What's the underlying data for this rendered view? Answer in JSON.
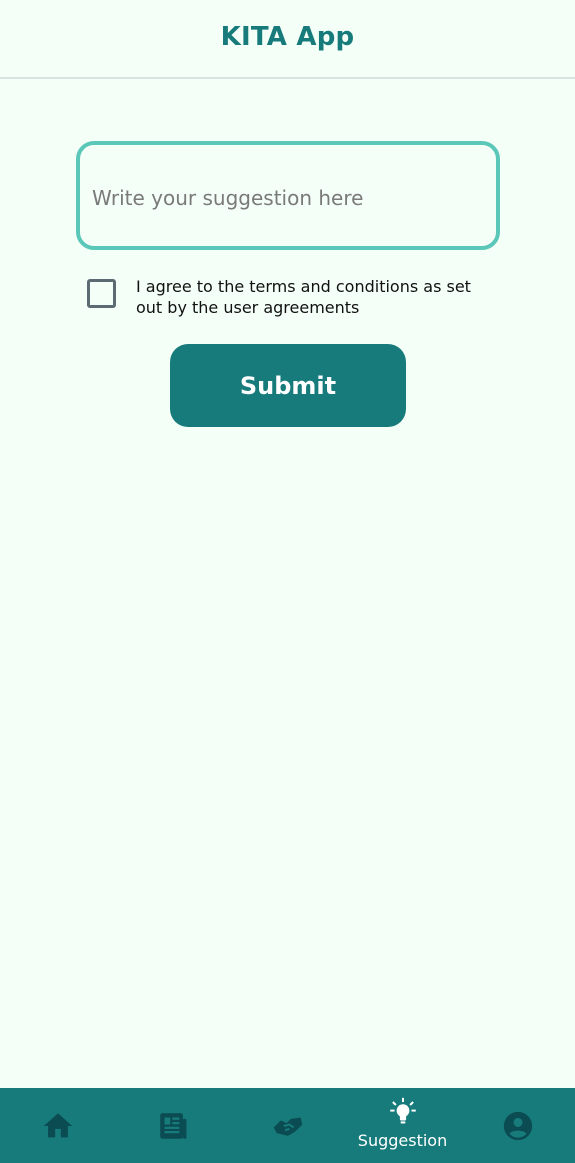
{
  "app": {
    "title": "KITA App"
  },
  "form": {
    "suggestion_placeholder": "Write your suggestion here",
    "suggestion_value": "",
    "agree_label": "I agree to the terms and conditions as set out by the user agreements",
    "agree_checked": false,
    "submit_label": "Submit"
  },
  "bottom_nav": {
    "items": [
      {
        "icon": "home-icon",
        "label": "",
        "active": false
      },
      {
        "icon": "newspaper-icon",
        "label": "",
        "active": false
      },
      {
        "icon": "handshake-icon",
        "label": "",
        "active": false
      },
      {
        "icon": "lightbulb-icon",
        "label": "Suggestion",
        "active": true
      },
      {
        "icon": "account-circle-icon",
        "label": "",
        "active": false
      }
    ]
  },
  "colors": {
    "primary": "#177b7b",
    "accent_border": "#5bc7b9",
    "background": "#f4fff7",
    "nav_icon_inactive": "#0b4b52",
    "nav_icon_active": "#ffffff"
  }
}
